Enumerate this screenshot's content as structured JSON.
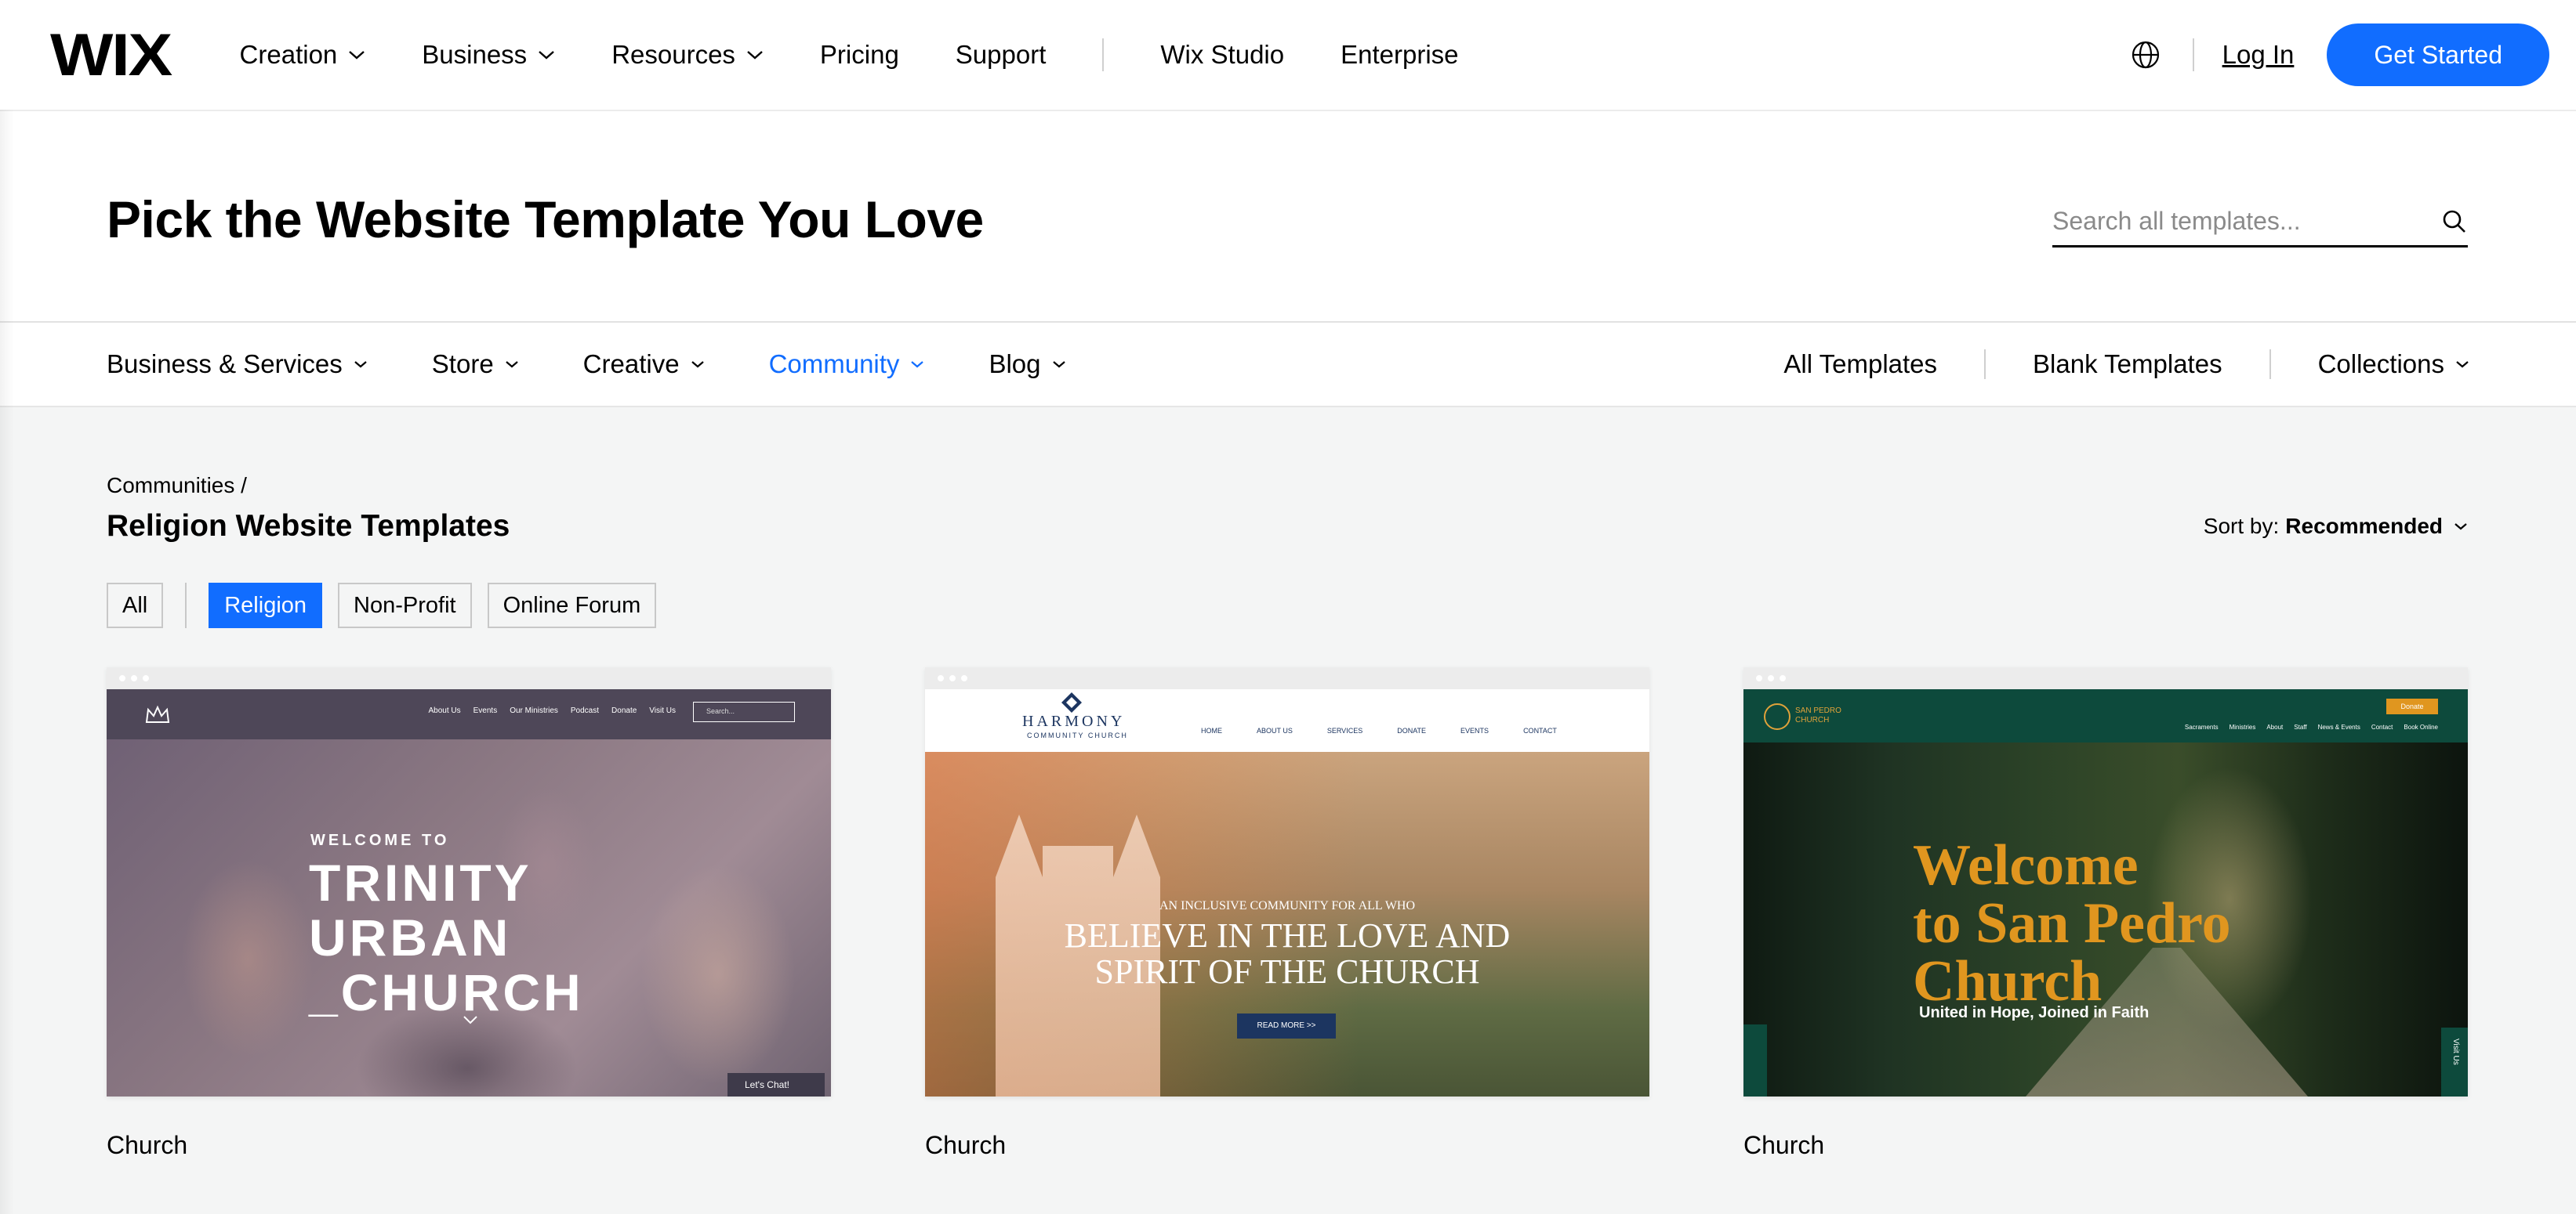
{
  "nav": {
    "logo": "WIX",
    "items": [
      {
        "label": "Creation",
        "dropdown": true
      },
      {
        "label": "Business",
        "dropdown": true
      },
      {
        "label": "Resources",
        "dropdown": true
      },
      {
        "label": "Pricing",
        "dropdown": false
      },
      {
        "label": "Support",
        "dropdown": false
      }
    ],
    "secondary": [
      "Wix Studio",
      "Enterprise"
    ],
    "login": "Log In",
    "cta": "Get Started",
    "globe_icon": "globe-icon"
  },
  "hero": {
    "title": "Pick the Website Template You Love",
    "search_placeholder": "Search all templates..."
  },
  "categories": {
    "items": [
      {
        "label": "Business & Services",
        "active": false
      },
      {
        "label": "Store",
        "active": false
      },
      {
        "label": "Creative",
        "active": false
      },
      {
        "label": "Community",
        "active": true
      },
      {
        "label": "Blog",
        "active": false
      }
    ],
    "right": {
      "all": "All Templates",
      "blank": "Blank Templates",
      "collections": "Collections"
    }
  },
  "content": {
    "breadcrumb": "Communities /",
    "title": "Religion Website Templates",
    "sort_label": "Sort by:",
    "sort_value": "Recommended",
    "filters": [
      {
        "label": "All",
        "selected": false
      },
      {
        "label": "Religion",
        "selected": true
      },
      {
        "label": "Non-Profit",
        "selected": false
      },
      {
        "label": "Online Forum",
        "selected": false
      }
    ]
  },
  "templates": [
    {
      "name": "Church",
      "preview": {
        "menu": [
          "About Us",
          "Events",
          "Our Ministries",
          "Podcast",
          "Donate",
          "Visit Us"
        ],
        "search": "Search...",
        "welcome": "WELCOME TO",
        "headline": "TRINITY\nURBAN\n_CHURCH",
        "chat": "Let's Chat!"
      }
    },
    {
      "name": "Church",
      "preview": {
        "logo": "HARMONY",
        "logo_sub": "COMMUNITY CHURCH",
        "menu": [
          "HOME",
          "ABOUT US",
          "SERVICES",
          "DONATE",
          "EVENTS",
          "CONTACT"
        ],
        "sub": "AN INCLUSIVE COMMUNITY FOR ALL WHO",
        "headline": "BELIEVE IN THE LOVE AND\nSPIRIT OF THE CHURCH",
        "button": "READ MORE >>"
      }
    },
    {
      "name": "Church",
      "preview": {
        "logo": "SAN PEDRO\nCHURCH",
        "donate": "Donate",
        "menu": [
          "Sacraments",
          "Ministries",
          "About",
          "Staff",
          "News & Events",
          "Contact",
          "Book Online"
        ],
        "headline": "Welcome\nto San Pedro\nChurch",
        "tagline": "United in Hope, Joined in Faith",
        "visit": "Visit Us"
      }
    }
  ],
  "colors": {
    "accent": "#116dff",
    "background": "#f4f5f5"
  }
}
